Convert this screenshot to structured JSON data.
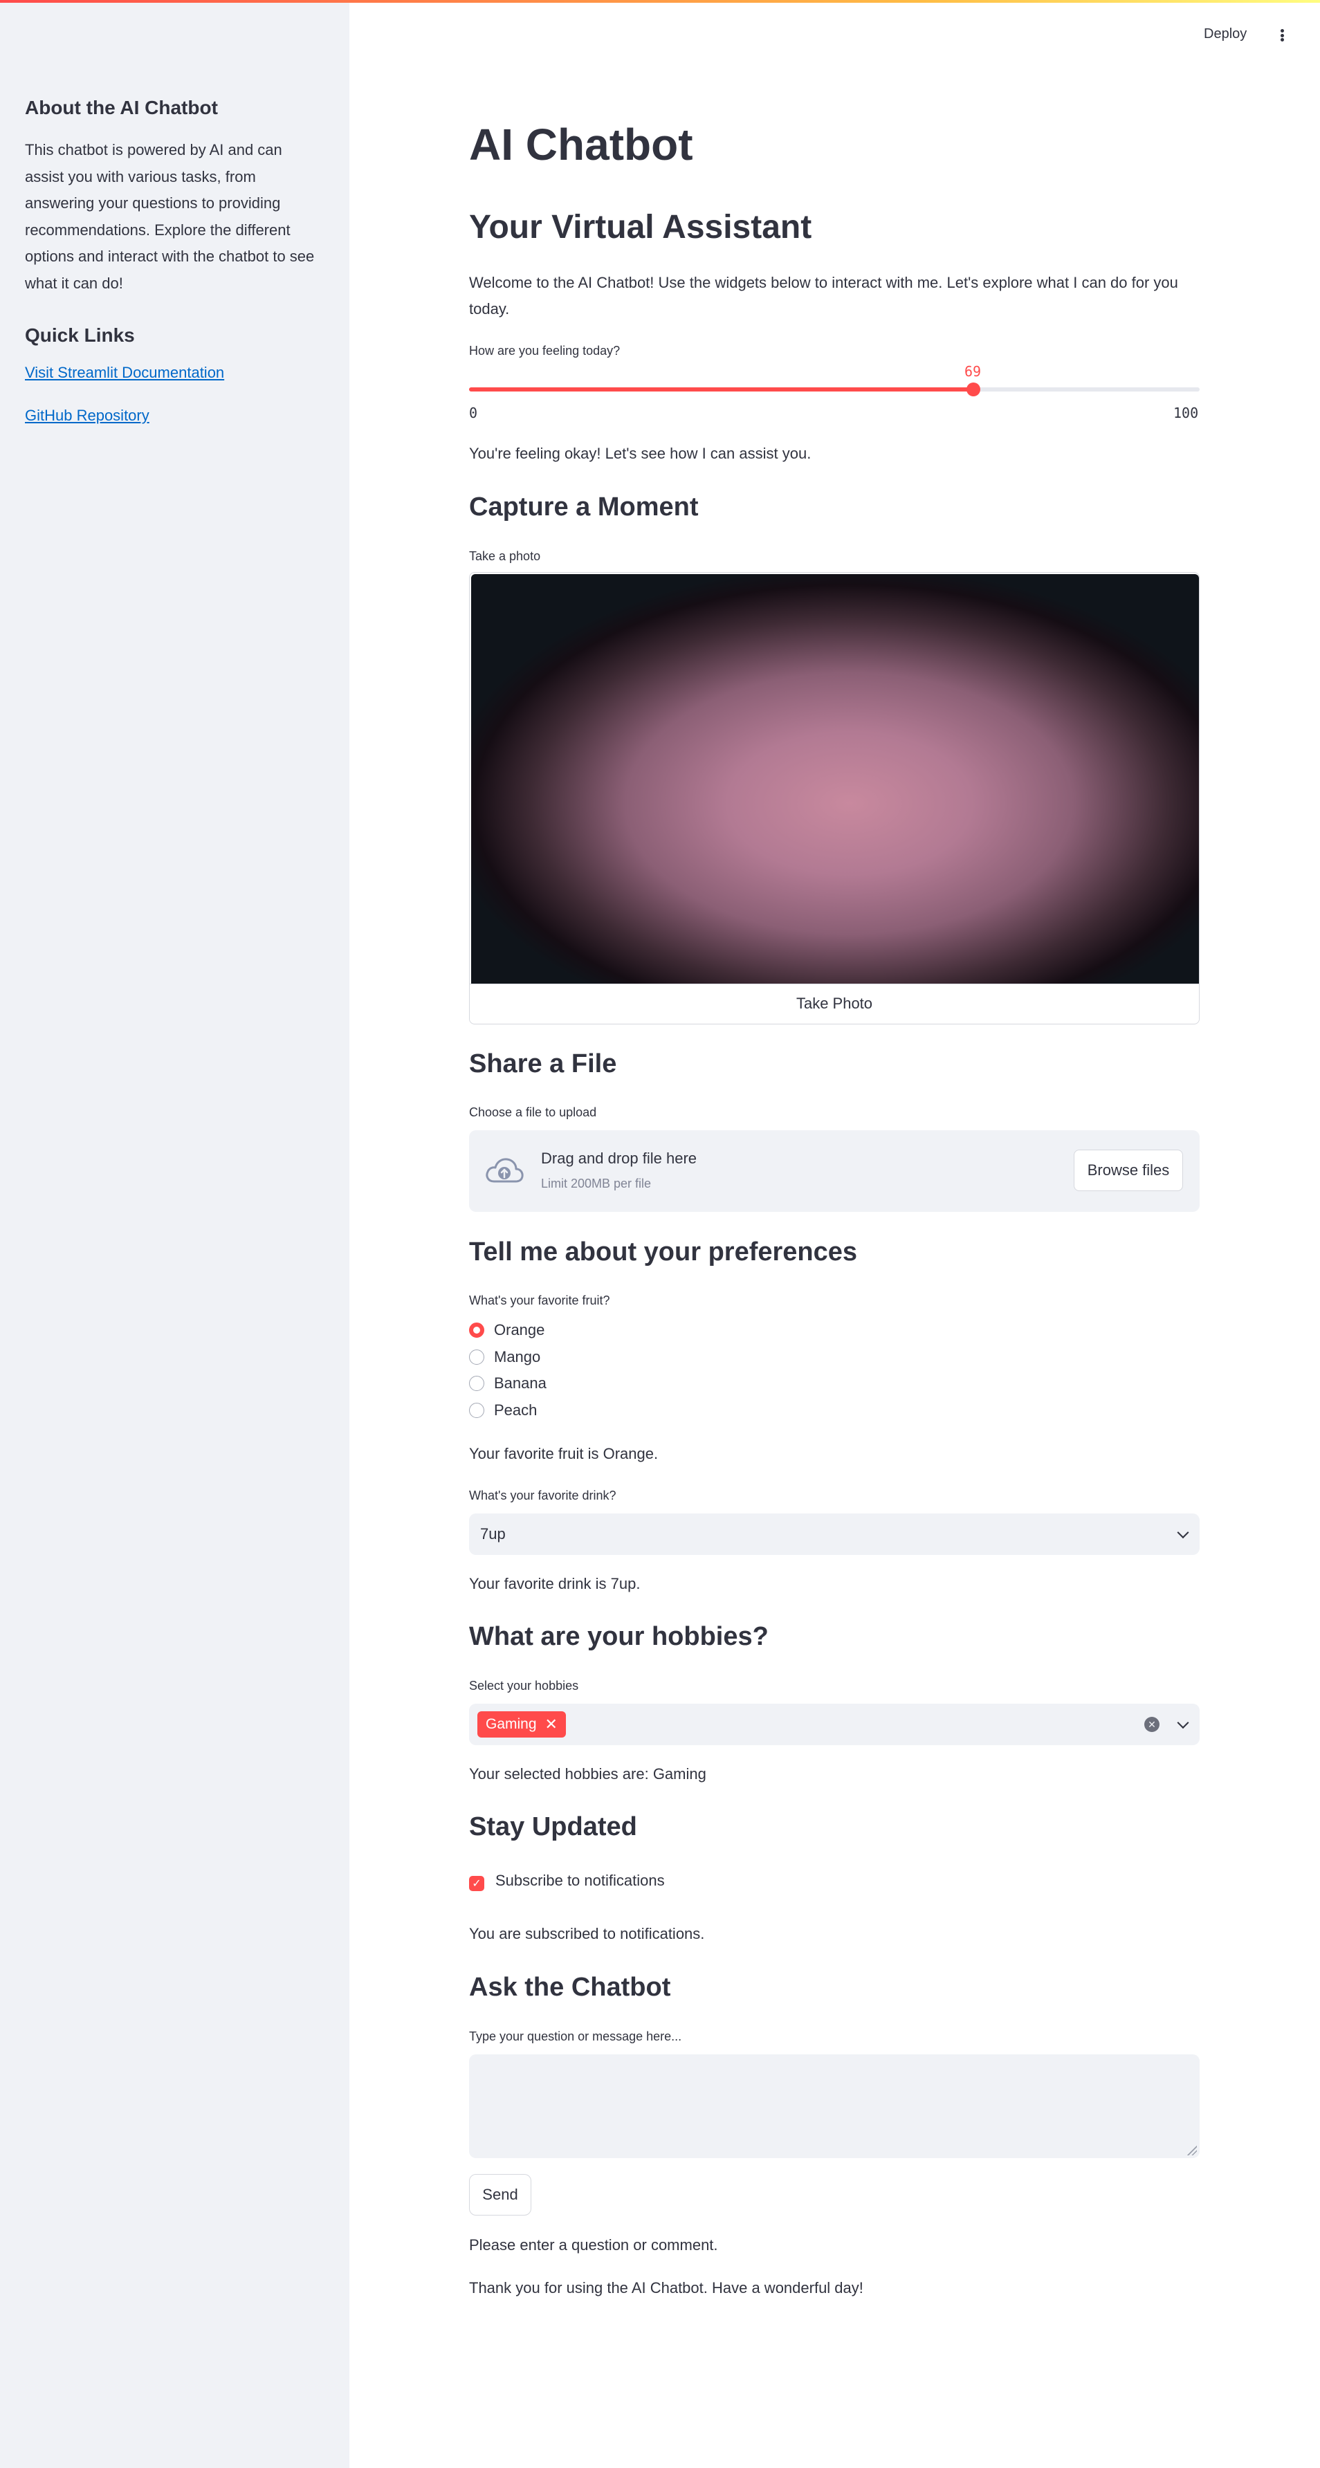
{
  "header": {
    "deploy_label": "Deploy",
    "menu_icon": "vertical-ellipsis-icon"
  },
  "sidebar": {
    "title": "About the AI Chatbot",
    "description": "This chatbot is powered by AI and can assist you with various tasks, from answering your questions to providing recommendations. Explore the different options and interact with the chatbot to see what it can do!",
    "links_title": "Quick Links",
    "links": [
      "Visit Streamlit Documentation",
      "GitHub Repository"
    ]
  },
  "main": {
    "title": "AI Chatbot",
    "subtitle": "Your Virtual Assistant",
    "welcome": "Welcome to the AI Chatbot! Use the widgets below to interact with me. Let's explore what I can do for you today.",
    "feeling": {
      "label": "How are you feeling today?",
      "value": "69",
      "min": "0",
      "max": "100",
      "message": "You're feeling okay! Let's see how I can assist you."
    },
    "capture": {
      "heading": "Capture a Moment",
      "label": "Take a photo",
      "button": "Take Photo"
    },
    "share": {
      "heading": "Share a File",
      "label": "Choose a file to upload",
      "drop_text": "Drag and drop file here",
      "limit_text": "Limit 200MB per file",
      "browse_label": "Browse files",
      "upload_icon": "cloud-upload-icon"
    },
    "preferences": {
      "heading": "Tell me about your preferences",
      "fruit_label": "What's your favorite fruit?",
      "fruits": [
        "Orange",
        "Mango",
        "Banana",
        "Peach"
      ],
      "selected_fruit": "Orange",
      "fruit_message": "Your favorite fruit is Orange.",
      "drink_label": "What's your favorite drink?",
      "drink_value": "7up",
      "drink_message": "Your favorite drink is 7up."
    },
    "hobbies": {
      "heading": "What are your hobbies?",
      "label": "Select your hobbies",
      "selected": [
        "Gaming"
      ],
      "message": "Your selected hobbies are: Gaming"
    },
    "updates": {
      "heading": "Stay Updated",
      "checkbox_label": "Subscribe to notifications",
      "checked": true,
      "message": "You are subscribed to notifications."
    },
    "ask": {
      "heading": "Ask the Chatbot",
      "label": "Type your question or message here...",
      "value": "",
      "send_label": "Send",
      "prompt_message": "Please enter a question or comment.",
      "footer": "Thank you for using the AI Chatbot. Have a wonderful day!"
    }
  },
  "colors": {
    "accent": "#ff4b4b",
    "sidebar_bg": "#f0f2f6",
    "link": "#0068c9",
    "text": "#31333f"
  }
}
